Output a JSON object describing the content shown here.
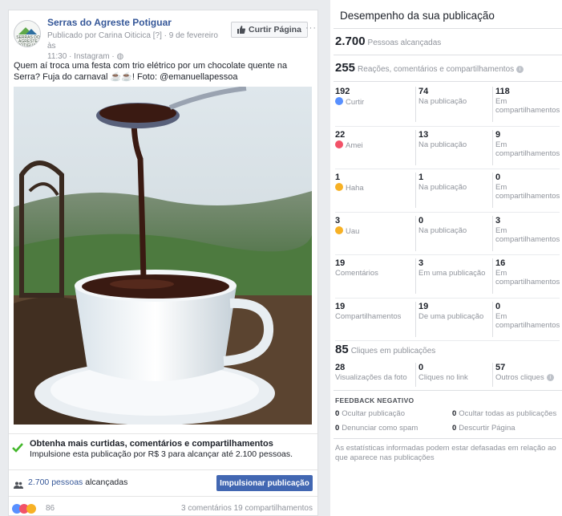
{
  "post": {
    "page_name": "Serras do Agreste Potiguar",
    "meta_line1": "Publicado por Carina Oiticica ",
    "meta_line1_suffix": "[?] · 9 de fevereiro às",
    "meta_line2": "11:30 · Instagram · ",
    "logo_text": "SERRAS DO AGRESTE POTIGUAR",
    "like_page_label": "Curtir Página",
    "more_label": "···",
    "text": "Quem aí troca uma festa com trio elétrico por um chocolate quente na Serra? Fuja do carnaval ☕☕! Foto: @emanuellapessoa",
    "boost_tip_title": "Obtenha mais curtidas, comentários e compartilhamentos",
    "boost_tip_sub": "Impulsione esta publicação por R$ 3 para alcançar até 2.100 pessoas.",
    "reach_link": "2.700 pessoas",
    "reach_suffix": " alcançadas",
    "boost_button": "Impulsionar publicação",
    "reaction_count": "86",
    "comments_shares": "3 comentários  19 compartilhamentos"
  },
  "insights": {
    "title": "Desempenho da sua publicação",
    "reach_value": "2.700",
    "reach_label": "Pessoas alcançadas",
    "engagement_value": "255",
    "engagement_label": "Reações, comentários e compartilhamentos",
    "rows": [
      {
        "total": "192",
        "label": "Curtir",
        "icon": "like-icon",
        "on_post": "74",
        "on_post_label": "Na publicação",
        "on_shares": "118",
        "on_shares_label": "Em compartilhamentos"
      },
      {
        "total": "22",
        "label": "Amei",
        "icon": "love-icon",
        "on_post": "13",
        "on_post_label": "Na publicação",
        "on_shares": "9",
        "on_shares_label": "Em compartilhamentos"
      },
      {
        "total": "1",
        "label": "Haha",
        "icon": "haha-icon",
        "on_post": "1",
        "on_post_label": "Na publicação",
        "on_shares": "0",
        "on_shares_label": "Em compartilhamentos"
      },
      {
        "total": "3",
        "label": "Uau",
        "icon": "wow-icon",
        "on_post": "0",
        "on_post_label": "Na publicação",
        "on_shares": "3",
        "on_shares_label": "Em compartilhamentos"
      },
      {
        "total": "19",
        "label": "Comentários",
        "icon": "",
        "on_post": "3",
        "on_post_label": "Em uma publicação",
        "on_shares": "16",
        "on_shares_label": "Em compartilhamentos"
      },
      {
        "total": "19",
        "label": "Compartilhamentos",
        "icon": "",
        "on_post": "19",
        "on_post_label": "De uma publicação",
        "on_shares": "0",
        "on_shares_label": "Em compartilhamentos"
      }
    ],
    "clicks_value": "85",
    "clicks_label": "Cliques em publicações",
    "photo_views": "28",
    "photo_views_label": "Visualizações da foto",
    "link_clicks": "0",
    "link_clicks_label": "Cliques no link",
    "other_clicks": "57",
    "other_clicks_label": "Outros cliques",
    "negative_title": "FEEDBACK NEGATIVO",
    "neg_hide_post_value": "0",
    "neg_hide_post_label": "Ocultar publicação",
    "neg_hide_all_value": "0",
    "neg_hide_all_label": "Ocultar todas as publicações",
    "neg_spam_value": "0",
    "neg_spam_label": "Denunciar como spam",
    "neg_unlike_value": "0",
    "neg_unlike_label": "Descurtir Página",
    "disclaimer": "As estatísticas informadas podem estar defasadas em relação ao que aparece nas publicações"
  },
  "colors": {
    "link": "#365899",
    "button": "#4267b2",
    "like": "#5890ff",
    "love": "#f25268",
    "haha": "#f7b125",
    "check": "#42b72a"
  }
}
